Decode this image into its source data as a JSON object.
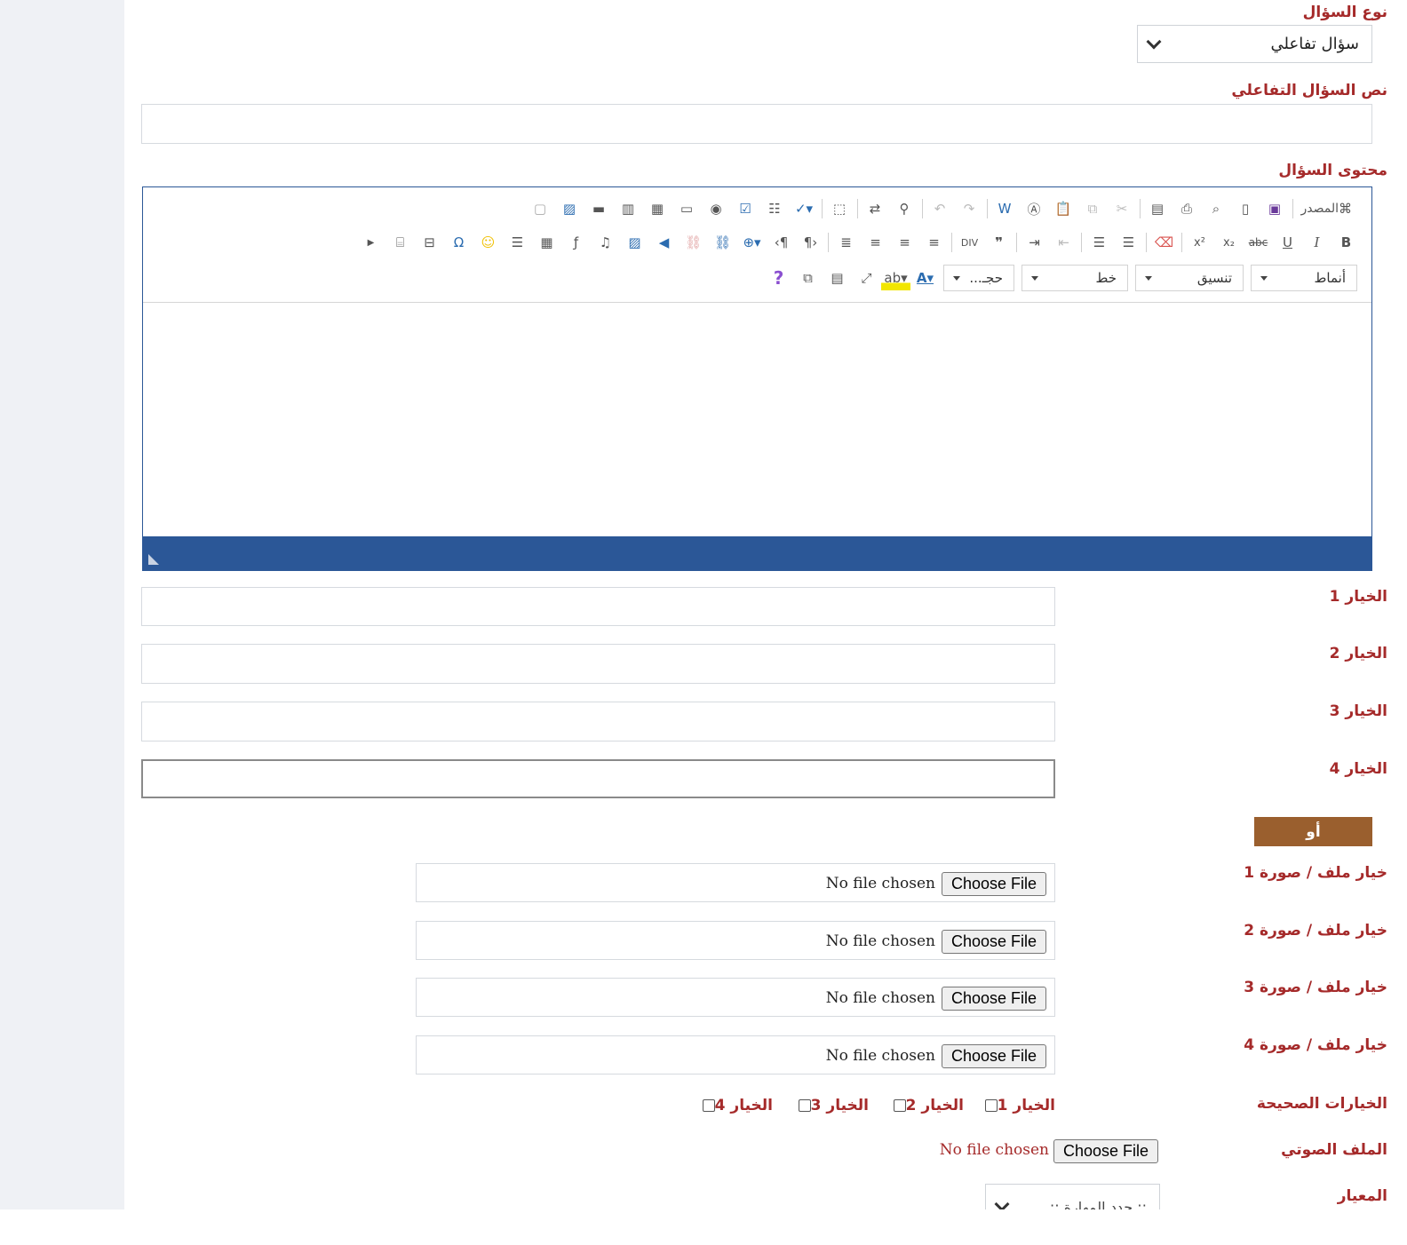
{
  "question_type": {
    "label": "نوع السؤال",
    "selected": "سؤال تفاعلي"
  },
  "interactive_text": {
    "label": "نص السؤال التفاعلي",
    "value": ""
  },
  "content": {
    "label": "محتوى السؤال"
  },
  "editor": {
    "source_label": "المصدر",
    "styles_label": "أنماط",
    "format_label": "تنسيق",
    "font_label": "خط",
    "size_label": "حجـ...",
    "help_label": "?"
  },
  "choices": [
    {
      "label": "الخيار 1",
      "value": ""
    },
    {
      "label": "الخيار 2",
      "value": ""
    },
    {
      "label": "الخيار 3",
      "value": ""
    },
    {
      "label": "الخيار 4",
      "value": ""
    }
  ],
  "or_label": "أو",
  "file_choices": [
    {
      "label": "خيار ملف / صورة 1",
      "button": "Choose File",
      "status": "No file chosen"
    },
    {
      "label": "خيار ملف / صورة 2",
      "button": "Choose File",
      "status": "No file chosen"
    },
    {
      "label": "خيار ملف / صورة 3",
      "button": "Choose File",
      "status": "No file chosen"
    },
    {
      "label": "خيار ملف / صورة 4",
      "button": "Choose File",
      "status": "No file chosen"
    }
  ],
  "correct": {
    "label": "الخيارات الصحيحة",
    "options": [
      "الخيار 1",
      "الخيار 2",
      "الخيار 3",
      "الخيار 4"
    ]
  },
  "audio": {
    "label": "الملف الصوتي",
    "button": "Choose File",
    "status": "No file chosen"
  },
  "criterion": {
    "label": "المعيار",
    "placeholder": ":: حدد المهارة ::"
  },
  "colors": {
    "label": "#a52a2a",
    "editor_bar": "#2b5797",
    "or_badge": "#9a5f2e"
  }
}
